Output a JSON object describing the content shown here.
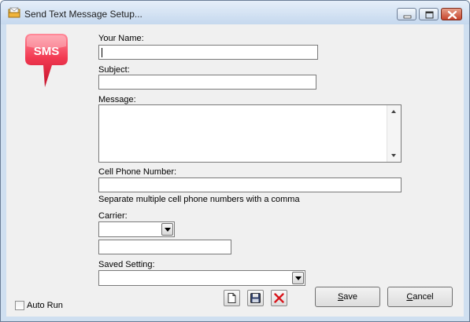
{
  "window": {
    "title": "Send Text Message Setup...",
    "icon": "envelope-folder-icon",
    "controls": [
      "minimize-icon",
      "maximize-icon",
      "close-icon"
    ]
  },
  "logo": {
    "text": "SMS",
    "color": "#e0233b"
  },
  "form": {
    "your_name": {
      "label": "Your Name:",
      "value": ""
    },
    "subject": {
      "label": "Subject:",
      "value": ""
    },
    "message": {
      "label": "Message:",
      "value": ""
    },
    "cell_phone": {
      "label": "Cell Phone Number:",
      "value": "",
      "hint": "Separate multiple cell phone numbers with a comma"
    },
    "carrier": {
      "label": "Carrier:",
      "selected": "",
      "other_value": ""
    },
    "saved_setting": {
      "label": "Saved Setting:",
      "selected": ""
    }
  },
  "toolbar": {
    "new_icon": "new-document-icon",
    "save_icon": "floppy-disk-icon",
    "delete_icon": "red-x-icon"
  },
  "buttons": {
    "save": {
      "accel": "S",
      "rest": "ave"
    },
    "cancel": {
      "accel": "C",
      "rest": "ancel"
    }
  },
  "auto_run": {
    "label": "Auto Run",
    "checked": false
  }
}
